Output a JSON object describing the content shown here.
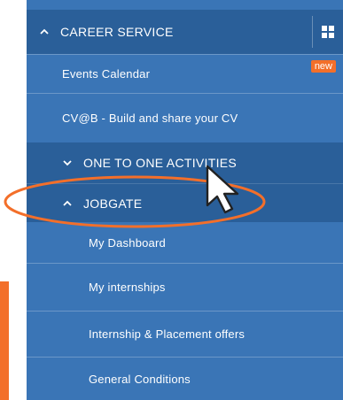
{
  "colors": {
    "panel": "#3a75b6",
    "panel_dark": "#2a5f99",
    "accent_orange": "#f36f2a",
    "text": "#ffffff"
  },
  "sections": {
    "career_service": {
      "label": "CAREER SERVICE",
      "icon": "chevron-up-icon",
      "expanded": true
    },
    "one_to_one": {
      "label": "ONE TO ONE ACTIVITIES",
      "icon": "chevron-down-icon",
      "expanded": false
    },
    "jobgate": {
      "label": "JOBGATE",
      "icon": "chevron-up-icon",
      "expanded": true
    }
  },
  "career_items": [
    {
      "label": "Events Calendar",
      "badge": "new"
    },
    {
      "label": "CV@B - Build and share your CV"
    }
  ],
  "jobgate_items": [
    {
      "label": "My Dashboard"
    },
    {
      "label": "My internships"
    },
    {
      "label": "Internship & Placement offers"
    },
    {
      "label": "General Conditions"
    }
  ],
  "icons": {
    "grid": "grid-icon",
    "cursor": "mouse-pointer-icon"
  }
}
